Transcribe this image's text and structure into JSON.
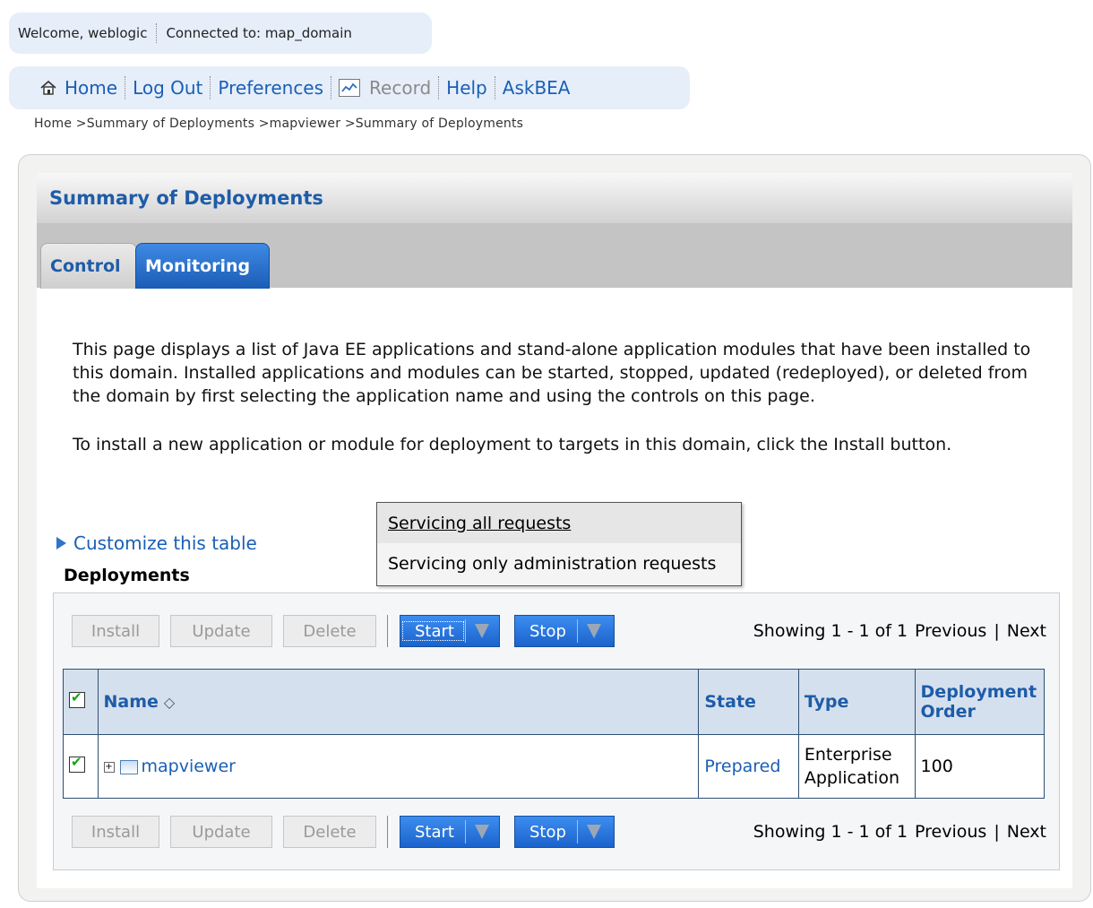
{
  "welcome": {
    "greeting": "Welcome, weblogic",
    "connection": "Connected to: map_domain"
  },
  "nav": {
    "home": "Home",
    "logout": "Log Out",
    "preferences": "Preferences",
    "record": "Record",
    "help": "Help",
    "askbea": "AskBEA"
  },
  "breadcrumb": "Home >Summary of Deployments >mapviewer >Summary of Deployments",
  "panel": {
    "title": "Summary of Deployments",
    "tabs": {
      "control": "Control",
      "monitoring": "Monitoring"
    },
    "desc1": "This page displays a list of Java EE applications and stand-alone application modules that have been installed to this domain. Installed applications and modules can be started, stopped, updated (redeployed), or deleted from the domain by first selecting the application name and using the controls on this page.",
    "desc2": "To install a new application or module for deployment to targets in this domain, click the Install button.",
    "customize": "Customize this table",
    "table_title": "Deployments"
  },
  "toolbar": {
    "install": "Install",
    "update": "Update",
    "delete": "Delete",
    "start": "Start",
    "stop": "Stop",
    "showing": "Showing 1 - 1 of 1",
    "previous": "Previous",
    "next": "Next"
  },
  "table": {
    "headers": {
      "name": "Name",
      "state": "State",
      "type": "Type",
      "order": "Deployment Order"
    },
    "rows": [
      {
        "name": "mapviewer",
        "state": "Prepared",
        "type": "Enterprise Application",
        "order": "100"
      }
    ]
  },
  "dropdown": {
    "items": [
      "Servicing all requests",
      "Servicing only administration requests"
    ]
  }
}
